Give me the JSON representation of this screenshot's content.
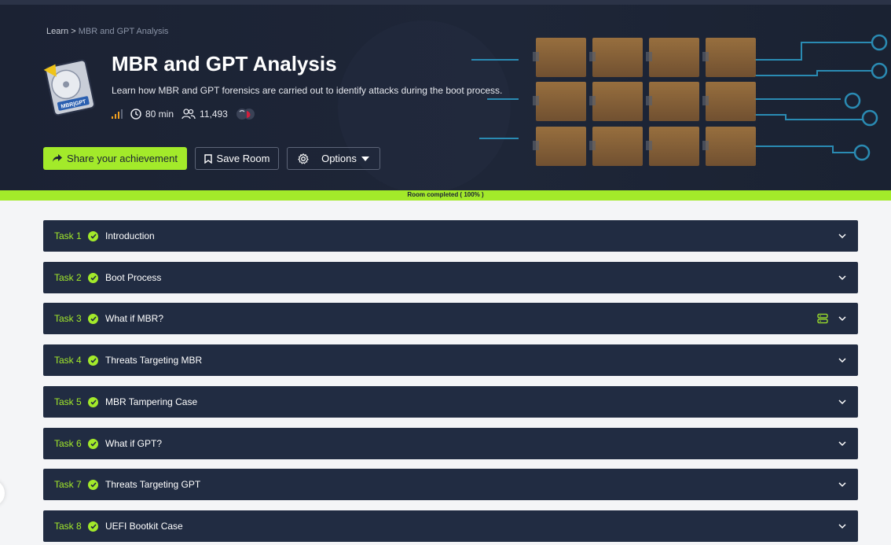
{
  "breadcrumb": {
    "root": "Learn",
    "separator": ">",
    "current": "MBR and GPT Analysis"
  },
  "room": {
    "title": "MBR and GPT Analysis",
    "description": "Learn how MBR and GPT forensics are carried out to identify attacks during the boot process.",
    "duration": "80 min",
    "users": "11,493",
    "icon_label": "MBR|GPT"
  },
  "buttons": {
    "share": "Share your achievement",
    "save": "Save Room",
    "options": "Options"
  },
  "progress": {
    "label": "Room completed ( 100% )",
    "percent": 100
  },
  "tasks": [
    {
      "num": "Task 1",
      "title": "Introduction"
    },
    {
      "num": "Task 2",
      "title": "Boot Process"
    },
    {
      "num": "Task 3",
      "title": "What if MBR?"
    },
    {
      "num": "Task 4",
      "title": "Threats Targeting MBR"
    },
    {
      "num": "Task 5",
      "title": "MBR Tampering Case"
    },
    {
      "num": "Task 6",
      "title": "What if GPT?"
    },
    {
      "num": "Task 7",
      "title": "Threats Targeting GPT"
    },
    {
      "num": "Task 8",
      "title": "UEFI Bootkit Case"
    }
  ],
  "colors": {
    "accent": "#a3ea2a",
    "hero_bg": "#1b2233",
    "task_bg": "#212c42"
  }
}
